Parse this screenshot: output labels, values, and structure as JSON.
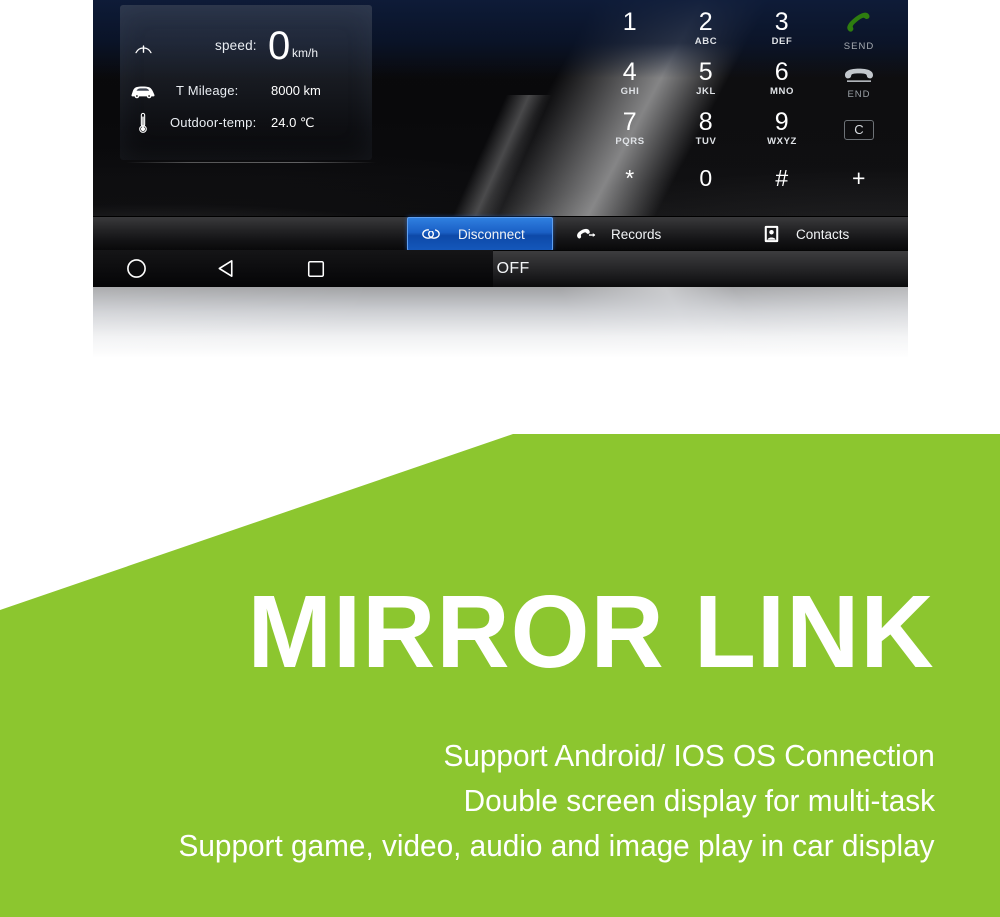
{
  "device": {
    "info_panel": {
      "rows": [
        {
          "icon": "speedometer-icon",
          "label": "speed:",
          "value": "0",
          "unit": "km/h"
        },
        {
          "icon": "car-icon",
          "label": "T Mileage:",
          "value": "8000 km"
        },
        {
          "icon": "thermometer-icon",
          "label": "Outdoor-temp:",
          "value": "24.0 ℃"
        }
      ]
    },
    "dialpad": {
      "keys": [
        {
          "digit": "1",
          "sub": ""
        },
        {
          "digit": "2",
          "sub": "ABC"
        },
        {
          "digit": "3",
          "sub": "DEF"
        },
        {
          "digit": "4",
          "sub": "GHI"
        },
        {
          "digit": "5",
          "sub": "JKL"
        },
        {
          "digit": "6",
          "sub": "MNO"
        },
        {
          "digit": "7",
          "sub": "PQRS"
        },
        {
          "digit": "8",
          "sub": "TUV"
        },
        {
          "digit": "9",
          "sub": "WXYZ"
        },
        {
          "digit": "*",
          "sub": ""
        },
        {
          "digit": "0",
          "sub": ""
        },
        {
          "digit": "#",
          "sub": ""
        },
        {
          "digit": "+",
          "sub": ""
        }
      ],
      "actions": {
        "send_label": "SEND",
        "end_label": "END",
        "clear_label": "C"
      },
      "colors": {
        "send_green": "#2e7d0f",
        "end_gray": "#bfc4c9"
      }
    },
    "tabs": [
      {
        "label": "Disconnect",
        "icon": "bluetooth-linked-icon",
        "active": true
      },
      {
        "label": "Records",
        "icon": "call-log-icon",
        "active": false
      },
      {
        "label": "Contacts",
        "icon": "contact-card-icon",
        "active": false
      }
    ],
    "air_bar": {
      "label": "Air OFF"
    },
    "nav_bar": {
      "buttons": [
        {
          "name": "home",
          "icon": "circle-icon"
        },
        {
          "name": "back",
          "icon": "triangle-left-icon"
        },
        {
          "name": "recents",
          "icon": "square-icon"
        }
      ]
    },
    "colors": {
      "tab_active_blue": "#1a5fc4",
      "screen_black": "#0a0a0c"
    }
  },
  "banner": {
    "title": "MIRROR LINK",
    "lines": [
      "Support Android/ IOS OS Connection",
      "Double screen display for multi-task",
      "Support game, video, audio and image play in car display"
    ],
    "colors": {
      "green": "#8cc62f",
      "text": "#ffffff"
    }
  }
}
